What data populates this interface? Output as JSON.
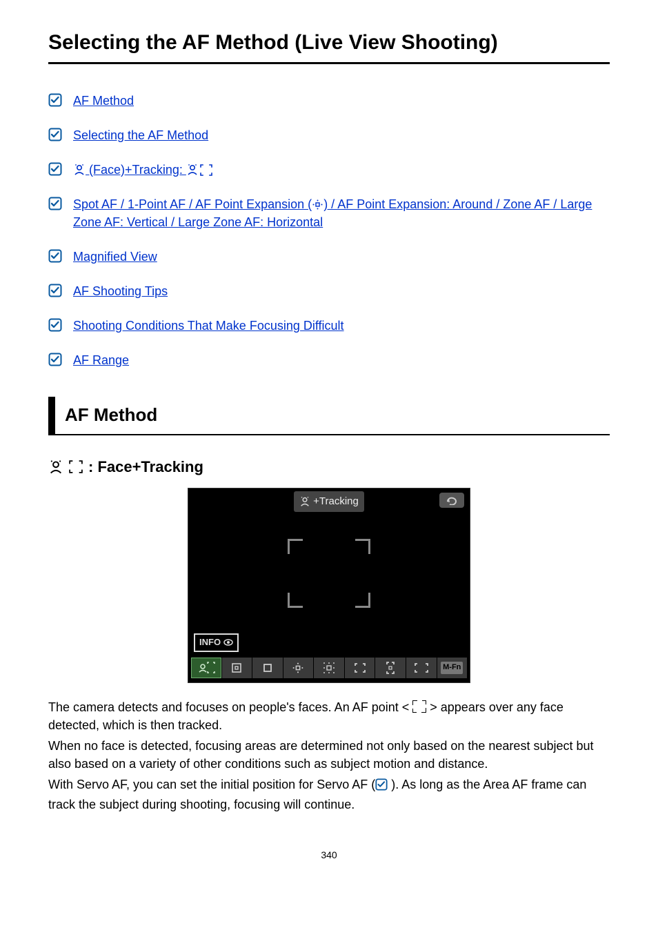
{
  "title": "Selecting the AF Method (Live View Shooting)",
  "links": {
    "i0": "AF Method",
    "i1": "Selecting the AF Method",
    "i2_a": " (Face)+Tracking: ",
    "i3": "Spot AF / 1-Point AF / AF Point Expansion (",
    "i3b": ") / AF Point Expansion: Around / Zone AF / Large Zone AF: Vertical / Large Zone AF: Horizontal",
    "i4": "Magnified View",
    "i5": "AF Shooting Tips",
    "i6": "Shooting Conditions That Make Focusing Difficult",
    "i7": "AF Range"
  },
  "section_head": "AF Method",
  "subhead_suffix": ": Face+Tracking",
  "camera_ui": {
    "mode_label": "+Tracking",
    "info_label": "INFO",
    "mfn_label": "M-Fn"
  },
  "para": {
    "p1a": "The camera detects and focuses on people's faces. An AF point < ",
    "p1b": " > appears over any face detected, which is then tracked.",
    "p2": "When no face is detected, focusing areas are determined not only based on the nearest subject but also based on a variety of other conditions such as subject motion and distance.",
    "p3a": "With Servo AF, you can set the initial position for Servo AF (",
    "p3b": " ). As long as the Area AF frame can track the subject during shooting, focusing will continue."
  },
  "page_number": "340"
}
